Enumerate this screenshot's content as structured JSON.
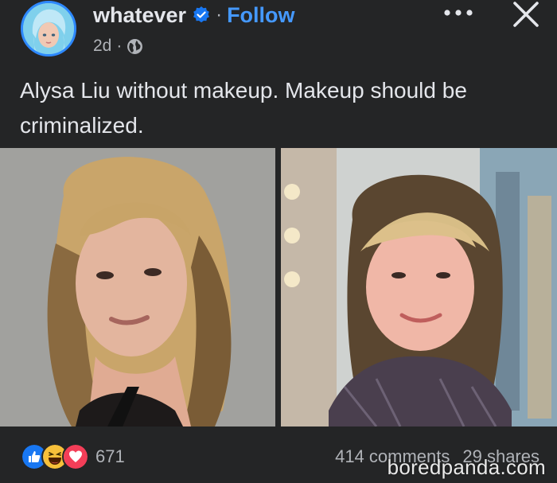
{
  "post": {
    "author": "whatever",
    "follow_label": "Follow",
    "separator": "·",
    "time": "2d",
    "caption": "Alysa Liu without makeup. Makeup should be criminalized."
  },
  "engagement": {
    "reaction_count": "671",
    "comments": "414 comments",
    "shares": "29 shares"
  },
  "watermark": "boredpanda.com",
  "icons": {
    "verified": "verified-badge-icon",
    "privacy": "globe-icon",
    "more": "more-options-icon",
    "close": "close-icon",
    "reactions": [
      "like-icon",
      "haha-icon",
      "love-icon"
    ]
  },
  "colors": {
    "background": "#242526",
    "follow": "#4599ff",
    "verified": "#1877f2",
    "text_primary": "#e4e6eb",
    "text_secondary": "#b0b3b8"
  }
}
